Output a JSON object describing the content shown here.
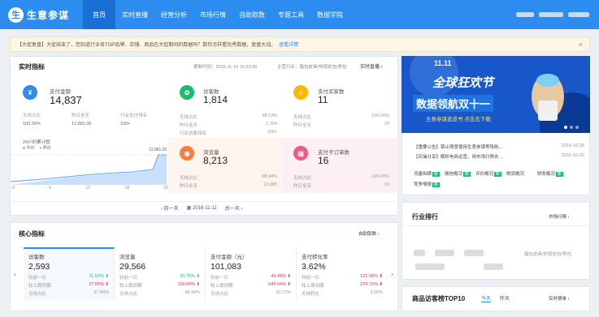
{
  "app": {
    "logo_char": "生",
    "logo_text": "生意参谋"
  },
  "nav": [
    "首页",
    "实时直播",
    "经营分析",
    "市场行情",
    "自助取数",
    "专题工具",
    "数据学院"
  ],
  "notice": {
    "text": "【大促复盘】大促结束了，您知道行业各TOP品牌、店铺、商品在大促期间的数据吗？数你怎样看优秀数据，复盘大战。",
    "link": "查看详情",
    "close": "×"
  },
  "realtime": {
    "title": "实时指标",
    "updated": "更新时间：2016-11-15 16:23:06",
    "category": "主营行业：箱包皮具/热销女包/男包",
    "live_link": "实时直播 ›",
    "pay_amount": {
      "label": "支付金额",
      "value": "14,837",
      "r1": [
        "无线占比",
        "昨日全天",
        "行业支付排名"
      ],
      "r2": [
        "100.00%",
        "12,881.00",
        "100+"
      ]
    },
    "chart": {
      "title": "24小时累计图",
      "legend_today": "今日",
      "legend_yesterday": "昨日",
      "top_value": "12,881.00",
      "x_ticks": [
        "0",
        "6",
        "12",
        "18",
        "23"
      ]
    },
    "visitors": {
      "label": "访客数",
      "value": "1,814",
      "rows": [
        [
          "无线占比",
          "98.13%"
        ],
        [
          "昨日全天",
          "2,304"
        ],
        [
          "行业访客排名",
          "100+"
        ]
      ]
    },
    "buyers": {
      "label": "支付买家数",
      "value": "11",
      "rows": [
        [
          "无线占比",
          "100.00%"
        ],
        [
          "昨日全天",
          "10"
        ]
      ]
    },
    "pageviews": {
      "label": "浏览量",
      "value": "8,213",
      "rows": [
        [
          "无线占比",
          "98.94%"
        ],
        [
          "昨日全天",
          "13,985"
        ]
      ]
    },
    "orders": {
      "label": "支付子订单数",
      "value": "16",
      "rows": [
        [
          "无线占比",
          "100.00%"
        ],
        [
          "昨日全天",
          "10"
        ]
      ]
    },
    "pager": {
      "prev": "‹ 前一天",
      "date": "2016-11-11",
      "next": "后一天 ›"
    }
  },
  "core": {
    "title": "核心指标",
    "link": "自助取数 ›",
    "cols": [
      {
        "label": "访客数",
        "value": "2,593",
        "rows": [
          [
            "较前一日",
            "11.62%",
            "down"
          ],
          [
            "较上周同期",
            "37.65%",
            "up"
          ],
          [
            "无线占比",
            "97.84%",
            ""
          ]
        ]
      },
      {
        "label": "浏览量",
        "value": "29,566",
        "rows": [
          [
            "较前一日",
            "30.75%",
            "down"
          ],
          [
            "较上周同期",
            "118.60%",
            "up"
          ],
          [
            "无线占比",
            "98.30%",
            ""
          ]
        ]
      },
      {
        "label": "支付金额（元）",
        "value": "101,083",
        "rows": [
          [
            "较前一日",
            "49.48%",
            "up"
          ],
          [
            "较上周同期",
            "649.04%",
            "up"
          ],
          [
            "无线占比",
            "92.72%",
            ""
          ]
        ]
      },
      {
        "label": "支付转化率",
        "value": "3.62%",
        "rows": [
          [
            "较前一日",
            "121.58%",
            "up"
          ],
          [
            "较上周同期",
            "224.70%",
            "up"
          ],
          [
            "无线转化",
            "3.50%",
            ""
          ]
        ]
      }
    ]
  },
  "banner": {
    "line1": "11.11",
    "line2": "全球狂欢节",
    "line3": "数据领航双十一",
    "line4": "生意参谋蓝皮书 点击去下载"
  },
  "news": [
    {
      "text": "【重要公告】禁止随意使用生意参谋等导航…",
      "date": "2016-10-28"
    },
    {
      "text": "【实操分享】解析电商运营，用市场行情去…",
      "date": "2016-10-20"
    }
  ],
  "tools": [
    [
      "流量纵横",
      "新"
    ],
    [
      "微信概况",
      "新"
    ],
    [
      "评价概况",
      "新"
    ],
    [
      "物流概况",
      ""
    ],
    [
      "财务概况",
      "新"
    ],
    [
      "竞争情报",
      "新"
    ]
  ],
  "rank": {
    "title": "行业排行",
    "link": "市场行情 ›",
    "category": "箱包皮具/热销女包/男包"
  },
  "top10": {
    "title": "商品访客榜TOP10",
    "tab_today": "今天",
    "tab_yesterday": "昨天",
    "link": "实时榜单 ›"
  },
  "colors": {
    "primary": "#2d8cf0",
    "blue_icon": "#2d8cf0",
    "green_icon": "#19be6b",
    "yellow_icon": "#ffb600",
    "orange_icon": "#ff7d3b",
    "pink_icon": "#ef5a83"
  }
}
